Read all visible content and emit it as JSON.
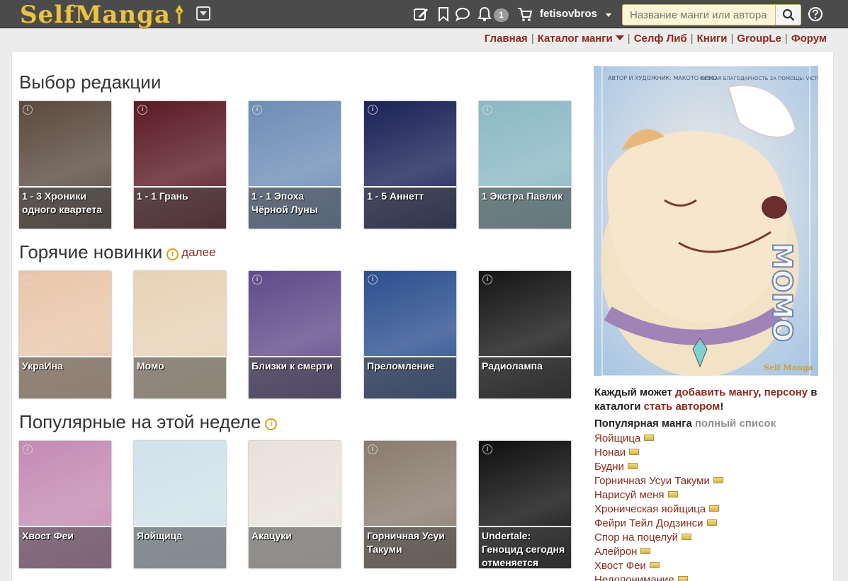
{
  "header": {
    "logo_text": "SelfManga",
    "notification_count": "1",
    "username": "fetisovbros",
    "search_placeholder": "Название манги или автора"
  },
  "nav": {
    "items": [
      "Главная",
      "Каталог манги",
      "Селф Либ",
      "Книги",
      "GroupLe",
      "Форум"
    ]
  },
  "sections": {
    "editors_choice": {
      "title": "Выбор редакции",
      "cards": [
        {
          "caption": "1 - 3 Хроники одного квартета",
          "bg": "#5a4a3e"
        },
        {
          "caption": "1 - 1 Грань",
          "bg": "#5b1a24"
        },
        {
          "caption": "1 - 1 Эпоха Чёрной Луны",
          "bg": "#6d8db6"
        },
        {
          "caption": "1 - 5 Аннетт",
          "bg": "#1a2257"
        },
        {
          "caption": "1 Экстра Павлик",
          "bg": "#8ab8c4"
        }
      ]
    },
    "hot_new": {
      "title": "Горячие новинки",
      "more": "далее",
      "cards": [
        {
          "caption": "УкраИна",
          "bg": "#e9c6a9"
        },
        {
          "caption": "Момо",
          "bg": "#e7d2b5"
        },
        {
          "caption": "Близки к смерти",
          "bg": "#5f4b8a"
        },
        {
          "caption": "Преломление",
          "bg": "#2c4f8f"
        },
        {
          "caption": "Радиолампа",
          "bg": "#151515"
        }
      ]
    },
    "popular_week": {
      "title": "Популярные на этой неделе",
      "cards": [
        {
          "caption": "Хвост Феи",
          "bg": "#c48bb3"
        },
        {
          "caption": "Яойщица",
          "bg": "#cfe1ea"
        },
        {
          "caption": "Акацуки",
          "bg": "#e8e2dc"
        },
        {
          "caption": "Горничная Усуи Такуми",
          "bg": "#8a7b6e"
        },
        {
          "caption": "Undertale: Геноцид сегодня отменяется",
          "bg": "#0f0f0f"
        }
      ]
    }
  },
  "sidebar": {
    "poster_title": "MOMO",
    "poster_credit_left": "АВТОР И ХУДОЖНИК: МАКОТО КИНО",
    "poster_credit_right": "ОСОБАЯ БЛАГОДАРНОСТЬ ЗА ПОМОЩЬ: VICTORIVRINA, АНАСТАСИЯ ЯРОВЕНКО, NATSU",
    "poster_brand": "Self Manga",
    "invite": {
      "t1": "Каждый может ",
      "l1": "добавить мангу",
      "t2": ", ",
      "l2": "персону",
      "t3": " в каталоги ",
      "l3": "стать автором",
      "t4": "!"
    },
    "popular_title": "Популярная манга",
    "popular_full": "полный список",
    "popular_list": [
      "Яойщица",
      "Нонаи",
      "Будни",
      "Горничная Усуи Такуми",
      "Нарисуй меня",
      "Хроническая яойщица",
      "Фейри Тейл Додзинси",
      "Спор на поцелуй",
      "Алейрон",
      "Хвост Феи",
      "Недопонимание"
    ]
  },
  "colors": {
    "topbar": "#4b4b4b",
    "link": "#8b2a1c",
    "logo": "#e7c34a",
    "info": "#d8a21a"
  }
}
